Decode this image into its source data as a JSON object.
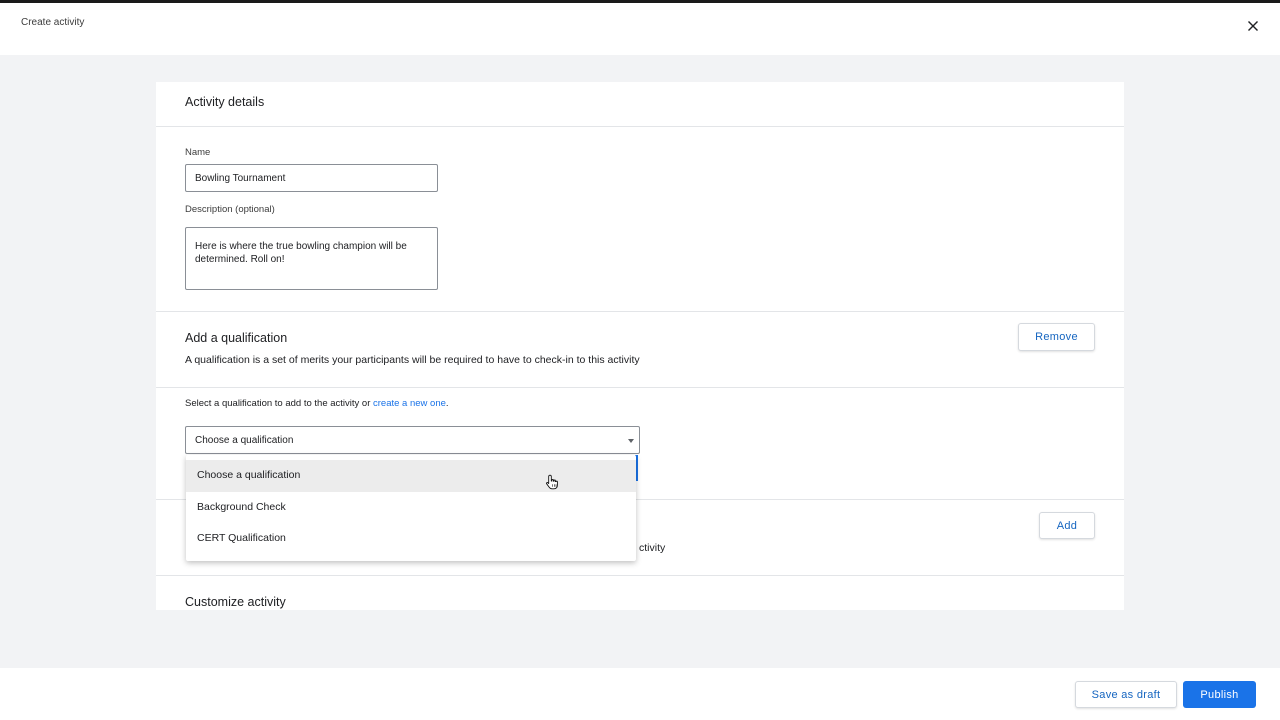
{
  "header": {
    "title": "Create activity",
    "close_icon": "close-icon"
  },
  "activity_details": {
    "title": "Activity details",
    "name_label": "Name",
    "name_value": "Bowling Tournament",
    "description_label": "Description (optional)",
    "description_value": "Here is where the true bowling champion will be determined. Roll on!"
  },
  "qualification": {
    "title": "Add a qualification",
    "description": "A qualification is a set of merits your participants will be required to have to check-in to this activity",
    "remove_label": "Remove",
    "select_prompt": "Select a qualification to add to the activity or ",
    "create_link": "create a new one",
    "select_prompt_end": ".",
    "select_value": "Choose a qualification",
    "options": [
      "Choose a qualification",
      "Background Check",
      "CERT Qualification"
    ]
  },
  "hidden_section": {
    "partial_text": "ctivity",
    "add_label": "Add"
  },
  "customize": {
    "title": "Customize activity"
  },
  "footer": {
    "save_draft_label": "Save as draft",
    "publish_label": "Publish"
  },
  "colors": {
    "accent": "#1a73e8",
    "link": "#1565c0",
    "background": "#f2f3f5"
  }
}
